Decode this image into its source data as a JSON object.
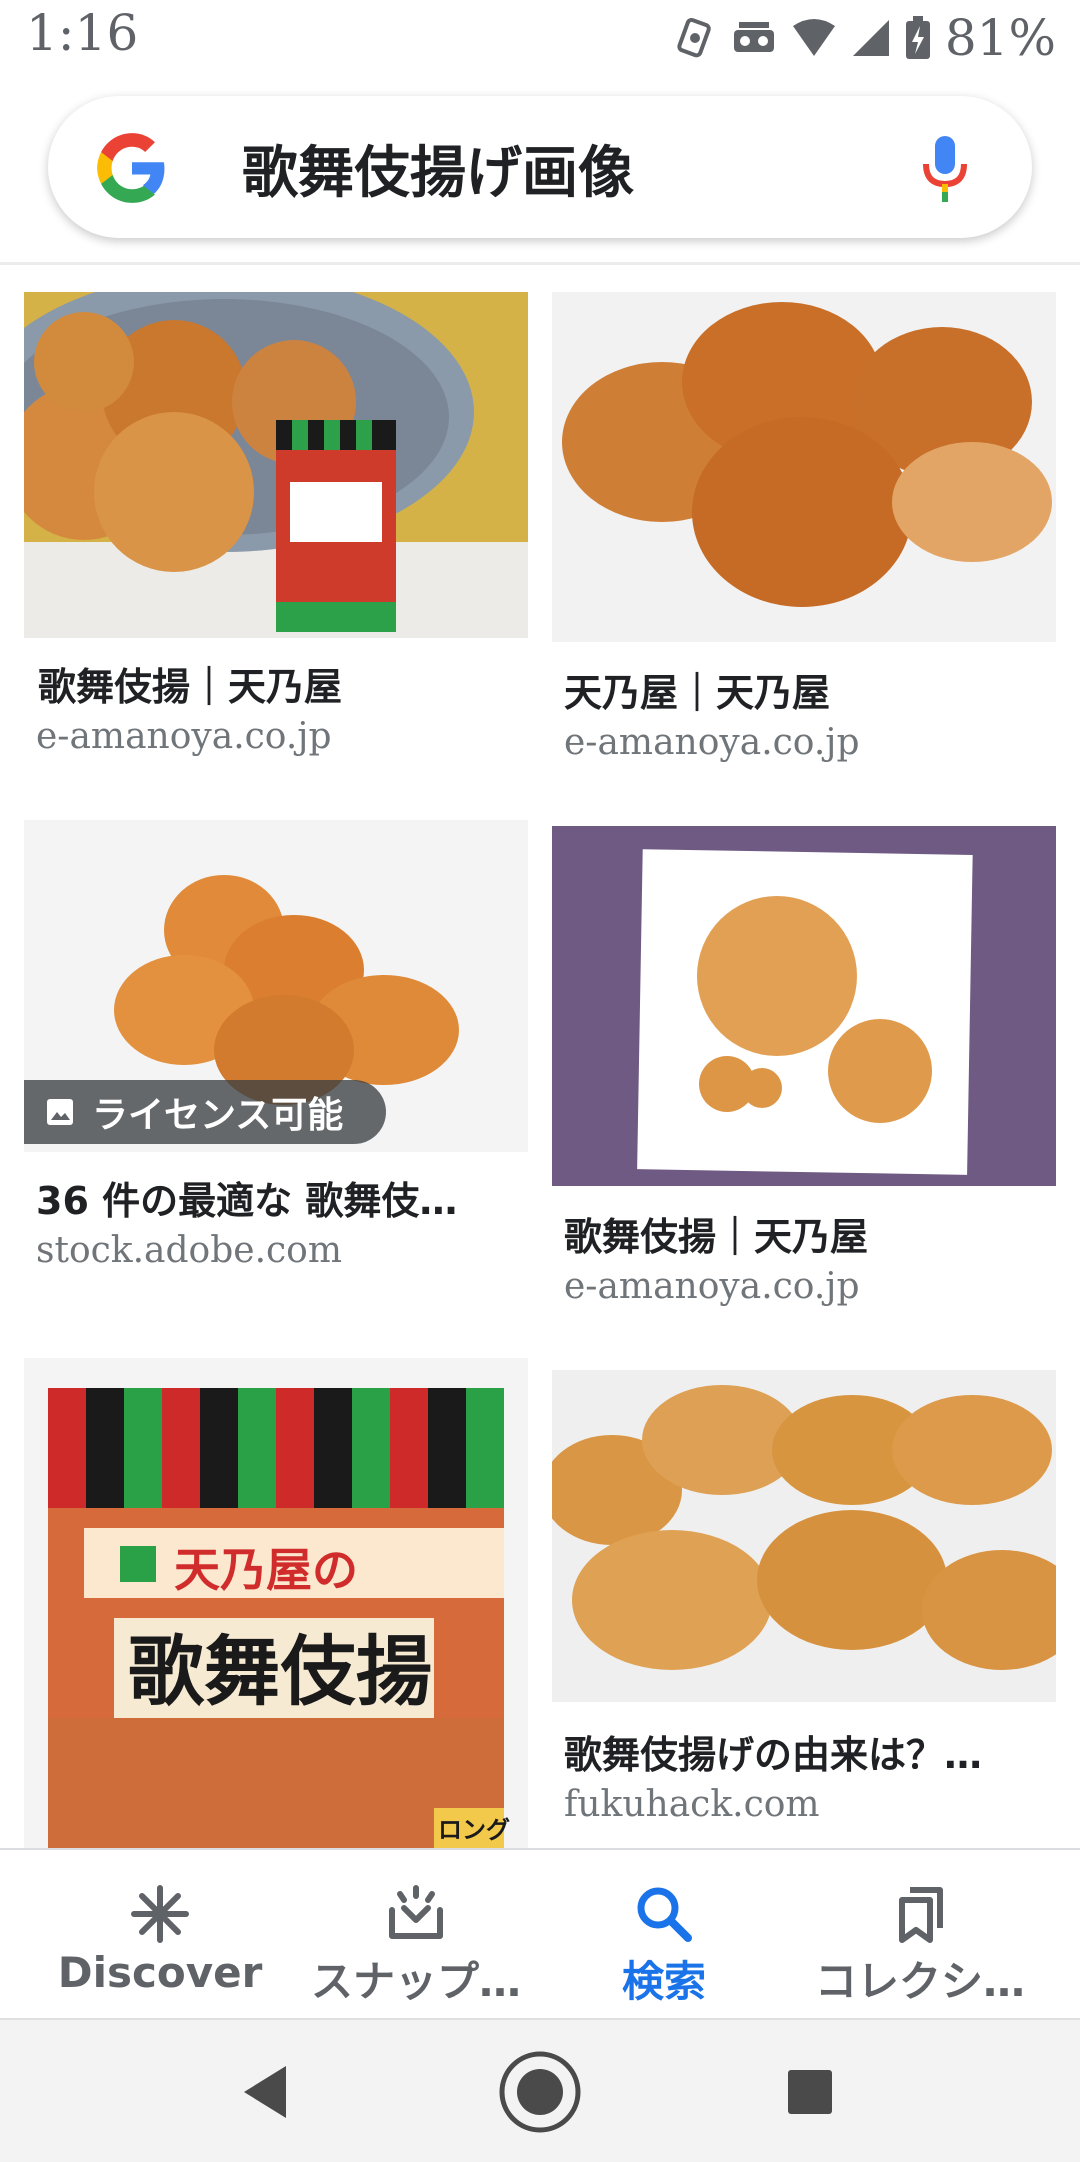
{
  "status": {
    "time": "1:16",
    "battery": "81%"
  },
  "search": {
    "query": "歌舞伎揚げ画像"
  },
  "results": [
    {
      "title": "歌舞伎揚｜天乃屋",
      "source": "e-amanoya.co.jp"
    },
    {
      "title": "天乃屋｜天乃屋",
      "source": "e-amanoya.co.jp"
    },
    {
      "title": "36 件の最適な 歌舞伎…",
      "source": "stock.adobe.com",
      "badge": "ライセンス可能"
    },
    {
      "title": "歌舞伎揚｜天乃屋",
      "source": "e-amanoya.co.jp"
    },
    {
      "title": "",
      "source": ""
    },
    {
      "title": "歌舞伎揚げの由来は？…",
      "source": "fukuhack.com"
    }
  ],
  "package": {
    "brand": "天乃屋の",
    "product": "歌舞伎揚",
    "small": "ロング"
  },
  "nav": [
    {
      "label": "Discover",
      "icon": "asterisk-icon"
    },
    {
      "label": "スナップ…",
      "icon": "snapshot-tray-icon"
    },
    {
      "label": "検索",
      "icon": "search-icon"
    },
    {
      "label": "コレクシ…",
      "icon": "collections-icon"
    }
  ],
  "colors": {
    "accent": "#1a73e8",
    "text": "#202124",
    "secondary": "#70757a"
  }
}
